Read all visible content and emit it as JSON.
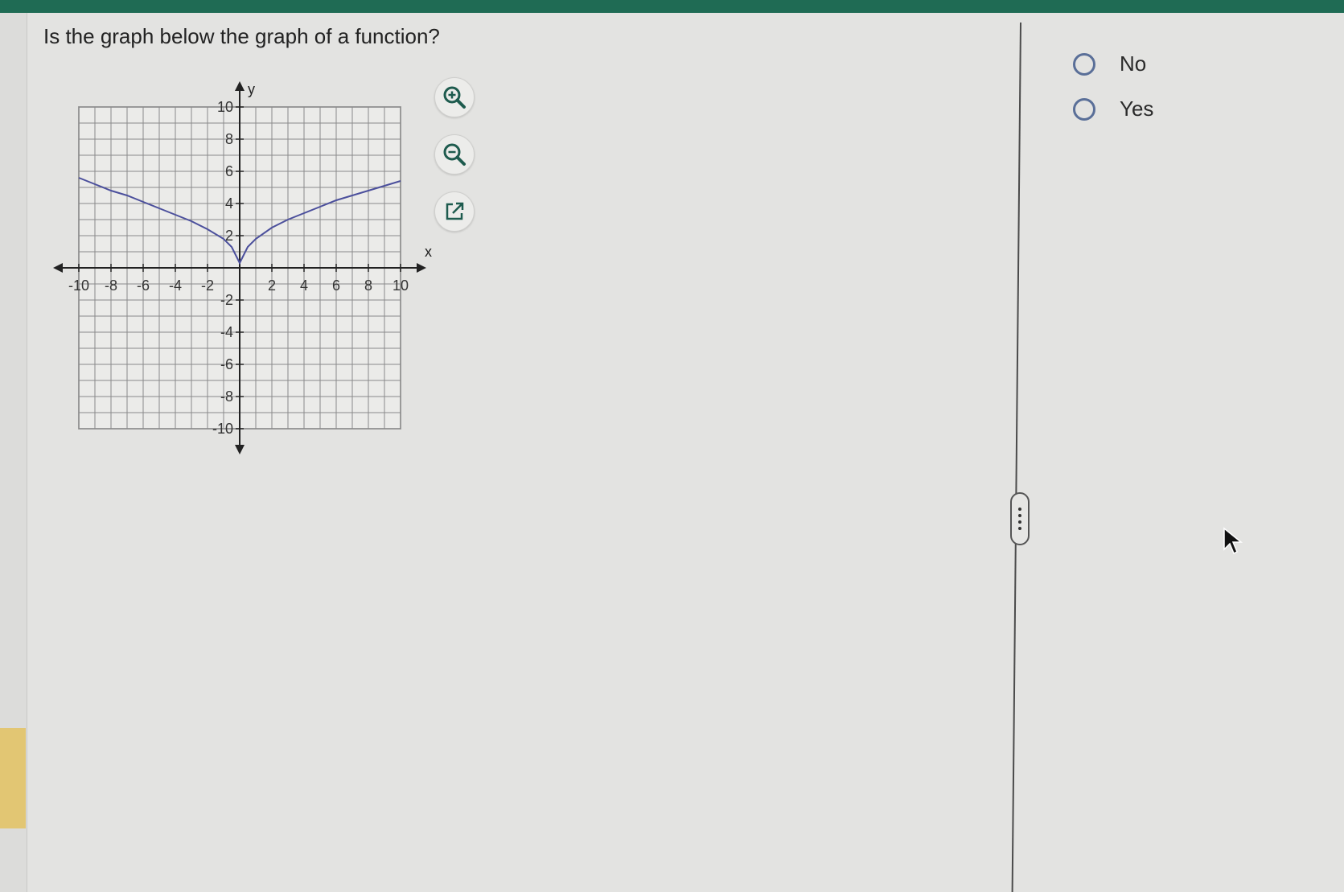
{
  "question": {
    "text": "Is the graph below the graph of a function?"
  },
  "tools": [
    {
      "icon": "zoom-in-icon"
    },
    {
      "icon": "zoom-out-icon"
    },
    {
      "icon": "external-link-icon"
    }
  ],
  "options": [
    {
      "label": "No",
      "selected": false
    },
    {
      "label": "Yes",
      "selected": false
    }
  ],
  "colors": {
    "top_bar": "#1f6b54",
    "curve": "#4b4f9c",
    "grid": "#8a8a8a",
    "radio": "#5a6f98",
    "left_tab": "#e2c673"
  },
  "chart_data": {
    "type": "line",
    "xlabel": "x",
    "ylabel": "y",
    "xlim": [
      -10,
      10
    ],
    "ylim": [
      -10,
      10
    ],
    "grid": true,
    "x_ticks": [
      "-10",
      "-8",
      "-6",
      "-4",
      "-2",
      "2",
      "4",
      "6",
      "8",
      "10"
    ],
    "y_ticks": [
      "10",
      "8",
      "6",
      "4",
      "2",
      "-2",
      "-4",
      "-6",
      "-8",
      "-10"
    ],
    "series": [
      {
        "x": [
          -10,
          -9,
          -8,
          -7,
          -6,
          -5,
          -4,
          -3,
          -2,
          -1,
          -0.5,
          0,
          0.5,
          1,
          2,
          3,
          4,
          5,
          6,
          7,
          8,
          9,
          10
        ],
        "y": [
          5.6,
          5.2,
          4.8,
          4.5,
          4.1,
          3.7,
          3.3,
          2.9,
          2.4,
          1.8,
          1.3,
          0.3,
          1.3,
          1.8,
          2.5,
          3.0,
          3.4,
          3.8,
          4.2,
          4.5,
          4.8,
          5.1,
          5.4
        ]
      }
    ]
  }
}
